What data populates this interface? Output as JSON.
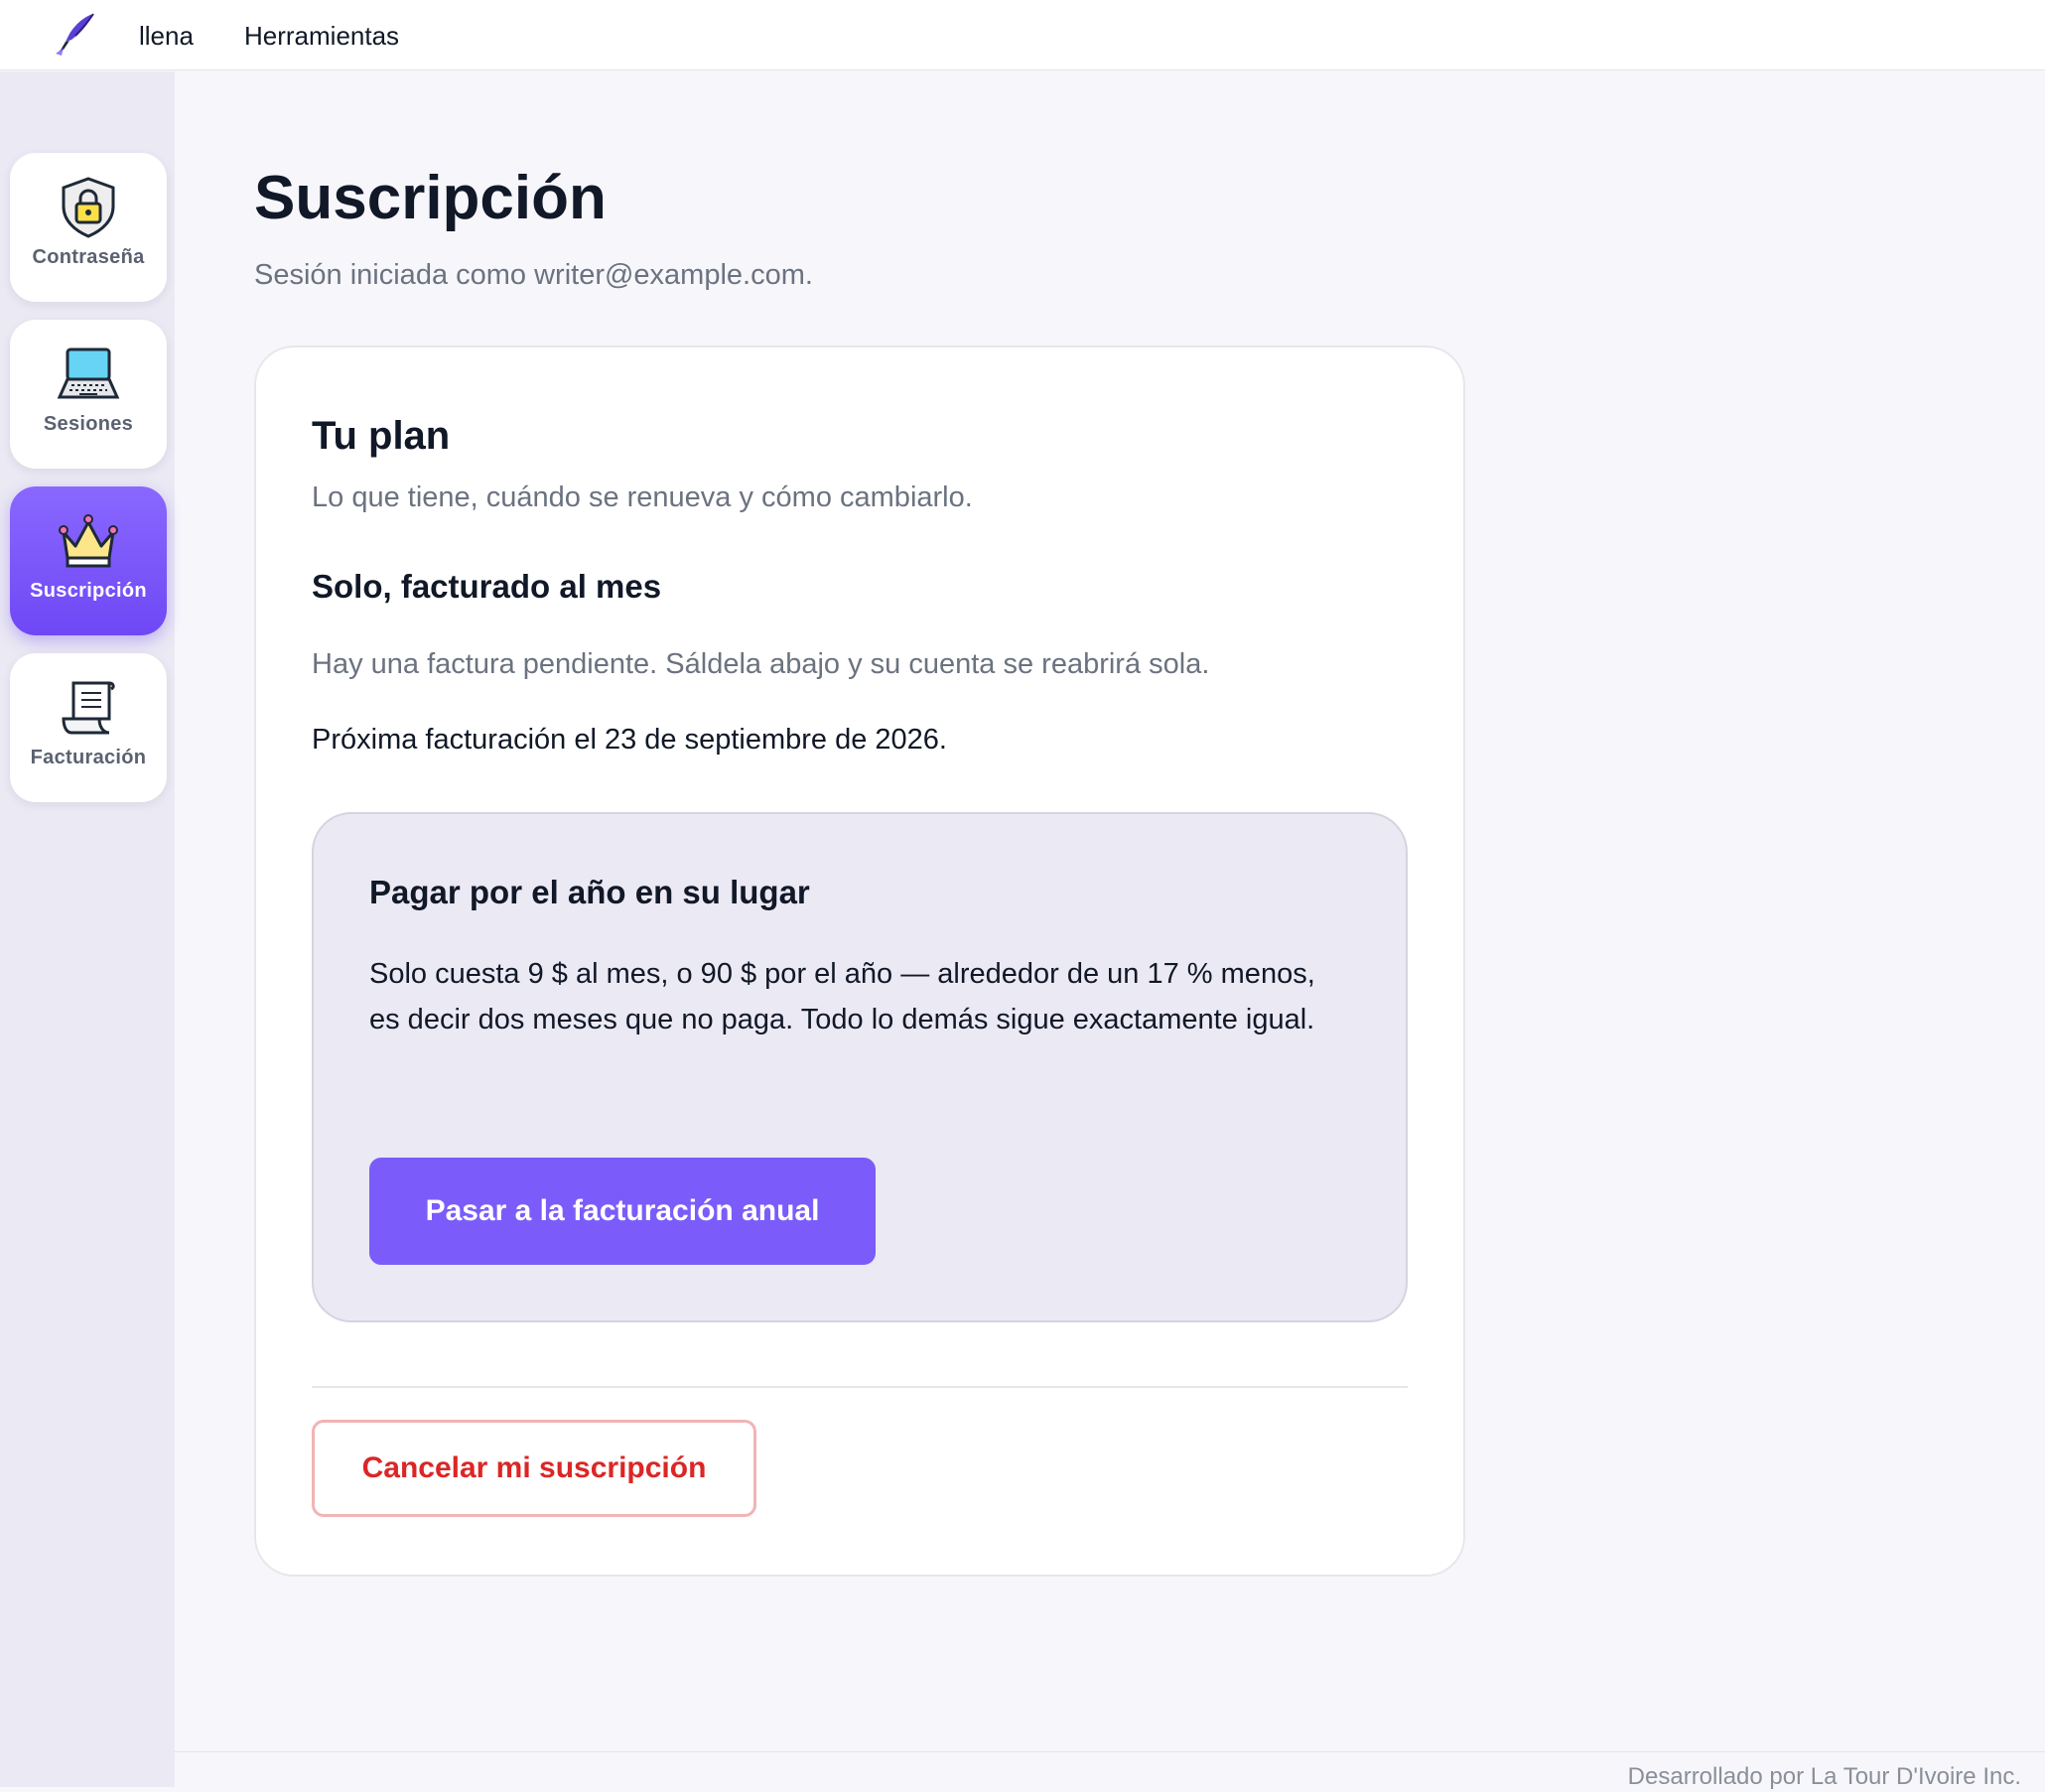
{
  "topbar": {
    "logo_icon": "quill-pen-icon",
    "nav": [
      {
        "label": "llena"
      },
      {
        "label": "Herramientas"
      }
    ]
  },
  "sidebar": {
    "items": [
      {
        "label": "Contraseña",
        "icon": "shield-lock-icon",
        "active": false
      },
      {
        "label": "Sesiones",
        "icon": "laptop-icon",
        "active": false
      },
      {
        "label": "Suscripción",
        "icon": "crown-icon",
        "active": true
      },
      {
        "label": "Facturación",
        "icon": "receipt-icon",
        "active": false
      }
    ]
  },
  "main": {
    "title": "Suscripción",
    "subtitle": "Sesión iniciada como writer@example.com.",
    "plan_card": {
      "title": "Tu plan",
      "subtitle": "Lo que tiene, cuándo se renueva y cómo cambiarlo.",
      "plan_name": "Solo, facturado al mes",
      "pending_note": "Hay una factura pendiente. Sáldela abajo y su cuenta se reabrirá sola.",
      "next_billing": "Próxima facturación el 23 de septiembre de 2026.",
      "annual_offer": {
        "title": "Pagar por el año en su lugar",
        "body": "Solo cuesta 9 $ al mes, o 90 $ por el año — alrededor de un 17 % menos, es decir dos meses que no paga. Todo lo demás sigue exactamente igual.",
        "button_label": "Pasar a la facturación anual"
      },
      "cancel_label": "Cancelar mi suscripción"
    }
  },
  "footer": {
    "text": "Desarrollado por La Tour D'Ivoire Inc."
  },
  "colors": {
    "accent": "#7b5cfa",
    "danger": "#dc2626",
    "sidebar_bg": "#ebe9f3",
    "page_bg": "#f7f7fb"
  }
}
